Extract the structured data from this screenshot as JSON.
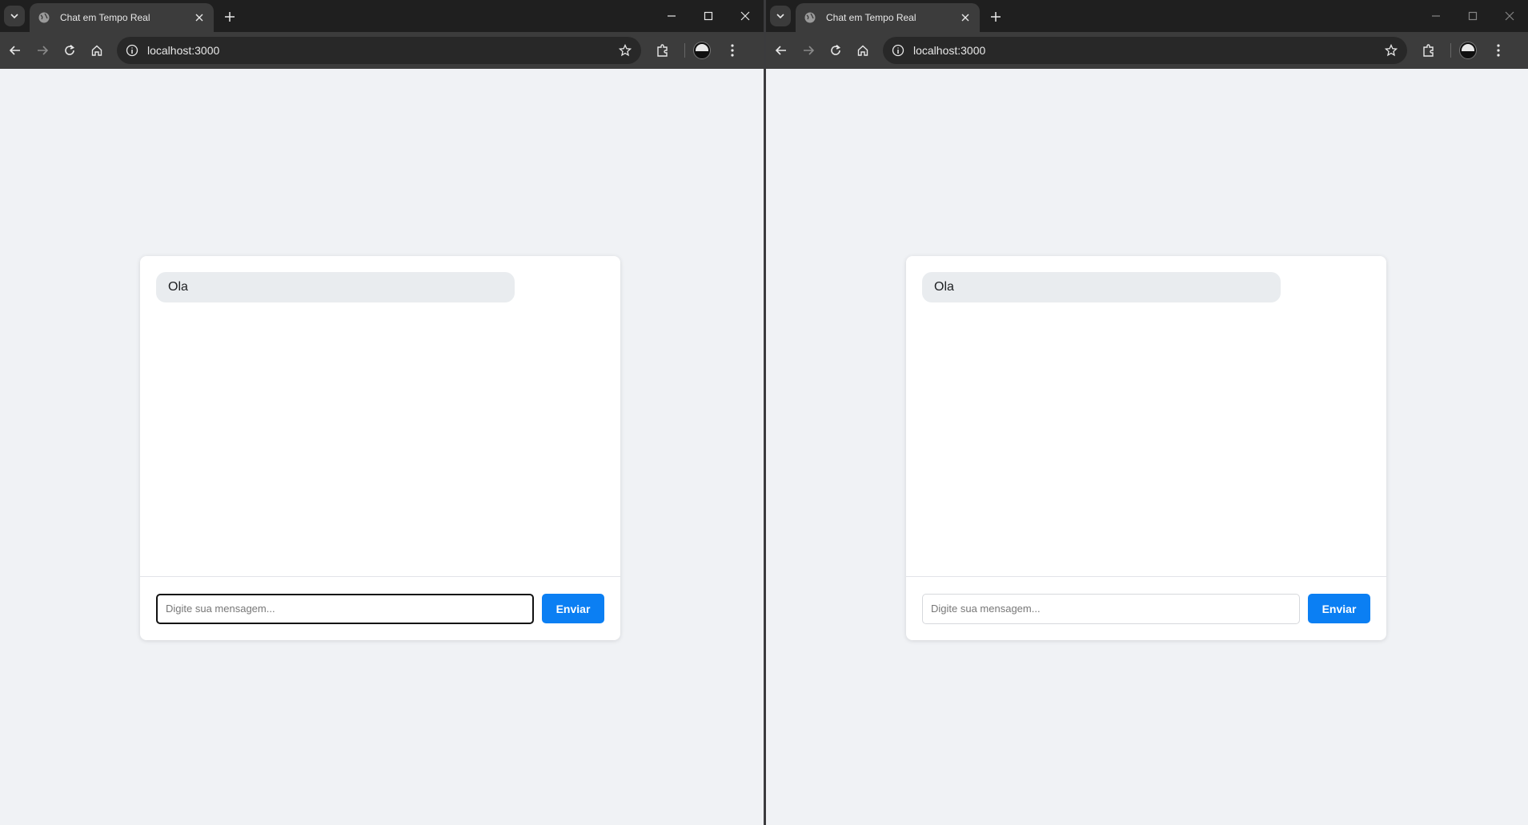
{
  "windows": [
    {
      "tab_title": "Chat em Tempo Real",
      "url": "localhost:3000",
      "messages": [
        {
          "text": "Ola"
        }
      ],
      "input": {
        "placeholder": "Digite sua mensagem...",
        "value": "",
        "focused": true
      },
      "send_label": "Enviar"
    },
    {
      "tab_title": "Chat em Tempo Real",
      "url": "localhost:3000",
      "messages": [
        {
          "text": "Ola"
        }
      ],
      "input": {
        "placeholder": "Digite sua mensagem...",
        "value": "",
        "focused": false
      },
      "send_label": "Enviar"
    }
  ],
  "icons": {
    "tab_search": "chevron-down-icon",
    "favicon": "globe-icon",
    "tab_close": "close-icon",
    "new_tab": "plus-icon",
    "minimize": "minimize-icon",
    "maximize": "maximize-icon",
    "close_window": "close-icon",
    "back": "arrow-left-icon",
    "forward": "arrow-right-icon",
    "reload": "reload-icon",
    "home": "home-icon",
    "site_info": "info-icon",
    "bookmark": "star-icon",
    "extensions": "puzzle-icon",
    "profile": "avatar",
    "menu": "kebab-menu-icon"
  },
  "colors": {
    "page_background": "#f0f2f5",
    "message_bubble": "#e9ecef",
    "send_button": "#0b7ff3"
  }
}
